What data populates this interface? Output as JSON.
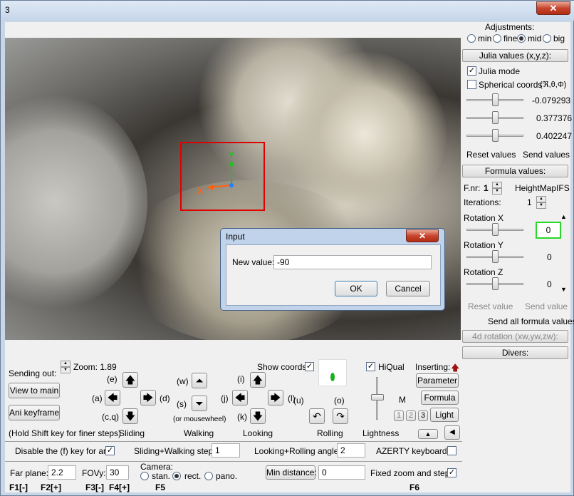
{
  "window": {
    "title": "3",
    "close": "✕"
  },
  "right": {
    "adjustments": "Adjustments:",
    "adj_options": [
      "min",
      "fine",
      "mid",
      "big"
    ],
    "julia_header": "Julia values (x,y,z):",
    "julia_mode": "Julia mode",
    "spherical": "Spherical coords",
    "spherical_sym": "(ℜ,θ,Φ)",
    "values": [
      "-0.079293",
      "0.377376",
      "0.402247"
    ],
    "reset_values": "Reset values",
    "send_values": "Send values",
    "formula_header": "Formula values:",
    "fnr_label": "F.nr:",
    "fnr_value": "1",
    "formula_name": "HeightMapIFS",
    "iterations_label": "Iterations:",
    "iterations_value": "1",
    "rot_x": "Rotation X",
    "rot_x_value": "0",
    "rot_y": "Rotation Y",
    "rot_y_value": "0",
    "rot_z": "Rotation Z",
    "rot_z_value": "0",
    "reset_value": "Reset value",
    "send_value": "Send value",
    "send_all": "Send all formula values",
    "rot4d": "4d rotation (xw,yw,zw):",
    "divers": "Divers:"
  },
  "dialog": {
    "title": "Input",
    "label": "New value:",
    "value": "-90",
    "ok": "OK",
    "cancel": "Cancel",
    "close": "✕"
  },
  "bottom": {
    "sending_out": "Sending out:",
    "zoom": "Zoom: 1.89",
    "view_to_main": "View to main",
    "ani_keyframe": "Ani keyframe",
    "hold_shift": "(Hold Shift key for finer steps)",
    "show_coords": "Show coords",
    "hiqual": "HiQual",
    "inserting": "Inserting:",
    "parameter": "Parameter",
    "formula": "Formula",
    "light": "Light",
    "m_label": "M",
    "light_nums": [
      "1",
      "2",
      "3"
    ],
    "keys": {
      "e": "(e)",
      "a": "(a)",
      "d": "(d)",
      "cq": "(c,q)",
      "w": "(w)",
      "s": "(s)",
      "i": "(i)",
      "j": "(j)",
      "l": "(l)",
      "k": "(k)",
      "u": "(u)",
      "o": "(o)"
    },
    "mousewheel": "(or mousewheel)",
    "sliding": "Sliding",
    "walking": "Walking",
    "looking": "Looking",
    "rolling": "Rolling",
    "lightness": "Lightness",
    "disable_f": "Disable the (f) key for ani",
    "sliding_walking": "Sliding+Walking step:",
    "sw_value": "1",
    "looking_rolling": "Looking+Rolling angle:",
    "lr_value": "2",
    "azerty": "AZERTY keyboard",
    "far_plane": "Far plane:",
    "far_value": "2.2",
    "fovy": "FOVy:",
    "fovy_value": "30",
    "camera": "Camera:",
    "cam_options": [
      "stan.",
      "rect.",
      "pano."
    ],
    "min_distance": "Min distance:",
    "min_value": "0",
    "fixed_zoom": "Fixed zoom and steps",
    "f1": "F1[-]",
    "f2": "F2[+]",
    "f3": "F3[-]",
    "f4": "F4[+]",
    "f5": "F5",
    "f6": "F6"
  },
  "viewport": {
    "x_axis": "X",
    "y_axis": "Y"
  }
}
